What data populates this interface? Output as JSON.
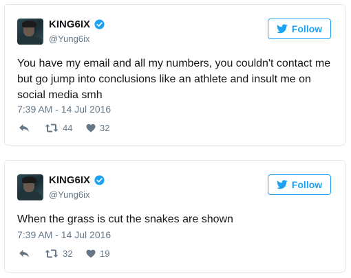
{
  "colors": {
    "accent": "#1da1f2",
    "text": "#14171a",
    "muted": "#657786",
    "border": "#e1e8ed"
  },
  "tweets": [
    {
      "display_name": "KING6IX",
      "handle": "@Yung6ix",
      "follow_label": "Follow",
      "text": "You have my email and all my numbers, you couldn't contact me but go jump into conclusions like an athlete and insult me on social media smh",
      "timestamp": "7:39 AM - 14 Jul 2016",
      "retweets": "44",
      "likes": "32",
      "icons": [
        "verified-badge-icon",
        "twitter-bird-icon",
        "reply-icon",
        "retweet-icon",
        "heart-icon"
      ]
    },
    {
      "display_name": "KING6IX",
      "handle": "@Yung6ix",
      "follow_label": "Follow",
      "text": "When the grass is cut the snakes are shown",
      "timestamp": "7:39 AM - 14 Jul 2016",
      "retweets": "32",
      "likes": "19",
      "icons": [
        "verified-badge-icon",
        "twitter-bird-icon",
        "reply-icon",
        "retweet-icon",
        "heart-icon"
      ]
    }
  ]
}
